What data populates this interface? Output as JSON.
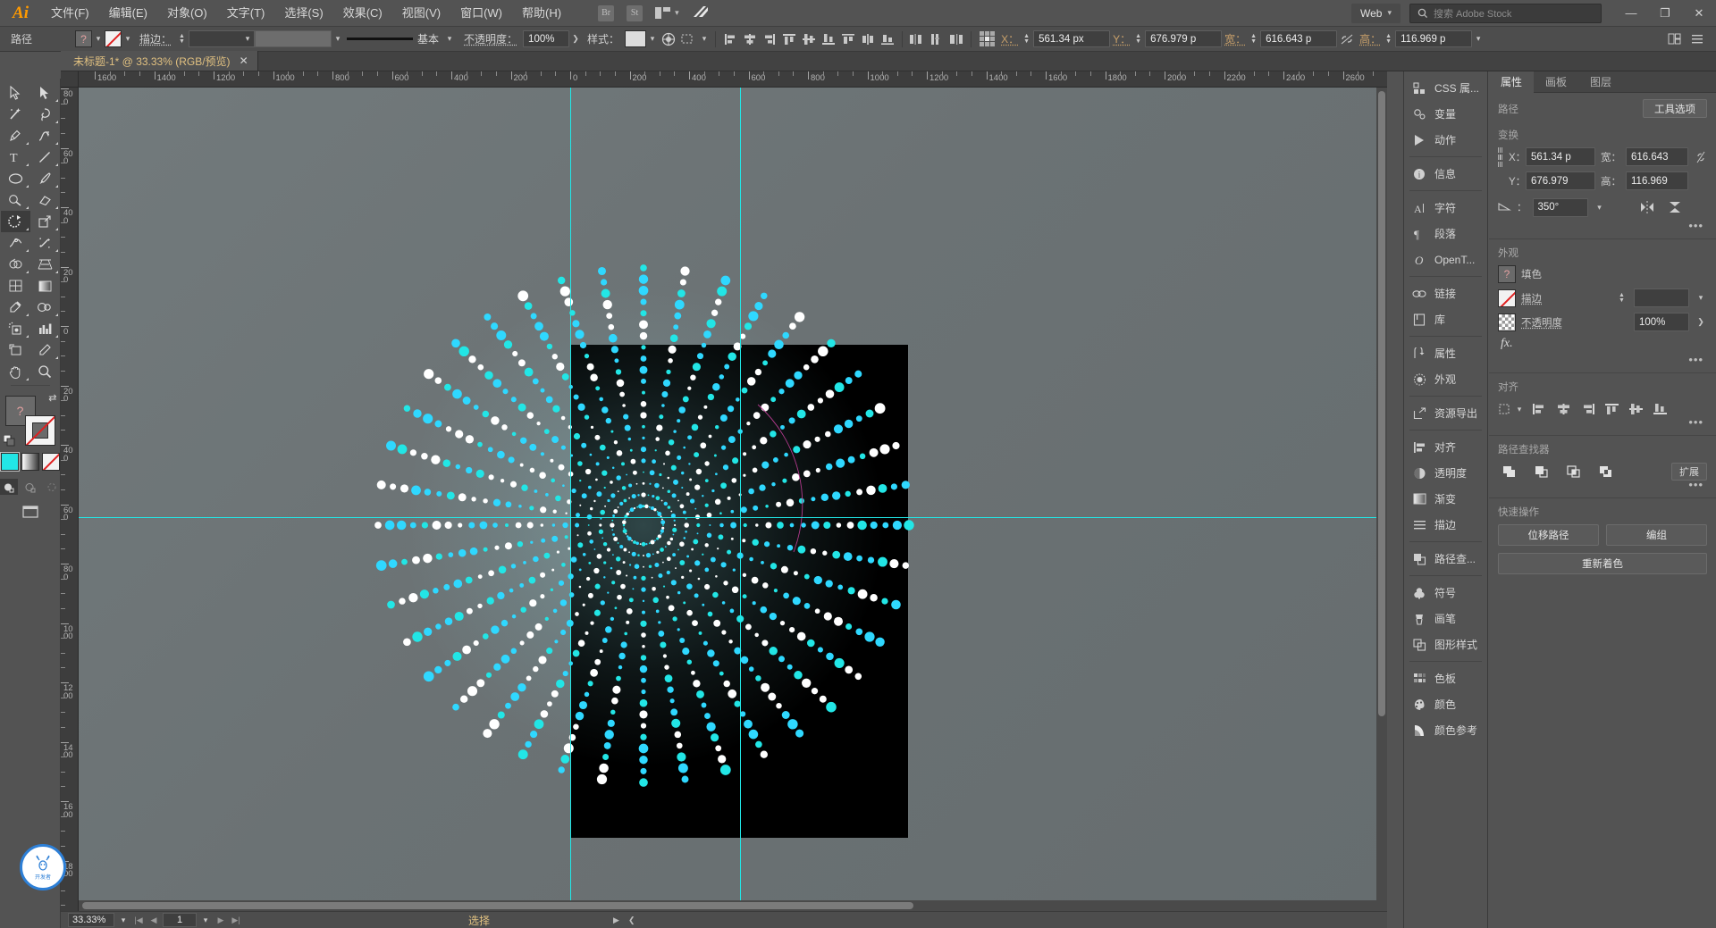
{
  "app": {
    "name": "Adobe Illustrator",
    "logo": "Ai"
  },
  "menubar": {
    "items": [
      {
        "label": "文件(F)"
      },
      {
        "label": "编辑(E)"
      },
      {
        "label": "对象(O)"
      },
      {
        "label": "文字(T)"
      },
      {
        "label": "选择(S)"
      },
      {
        "label": "效果(C)"
      },
      {
        "label": "视图(V)"
      },
      {
        "label": "窗口(W)"
      },
      {
        "label": "帮助(H)"
      }
    ],
    "bridge_label": "Br",
    "stock_label": "St",
    "workspace_label": "Web",
    "search_placeholder": "搜索 Adobe Stock",
    "window_minimize": "—",
    "window_restore": "❐",
    "window_close": "✕"
  },
  "controlbar": {
    "object_type": "路径",
    "fill_swatch": "?",
    "stroke_label": "描边：",
    "stroke_weight": "",
    "brush_label": "基本",
    "opacity_label": "不透明度：",
    "opacity_value": "100%",
    "style_label": "样式：",
    "x_label": "X：",
    "x_value": "561.34 px",
    "y_label": "Y：",
    "y_value": "676.979 p",
    "w_label": "宽：",
    "w_value": "616.643 p",
    "h_label": "高：",
    "h_value": "116.969 p"
  },
  "tabs": [
    {
      "title": "未标题-1* @ 33.33% (RGB/预览)",
      "close": "✕",
      "active": true
    }
  ],
  "toolbar": {
    "tools": [
      {
        "name": "selection-tool",
        "label": "选择工具"
      },
      {
        "name": "direct-selection-tool",
        "label": "直接选择工具"
      },
      {
        "name": "magic-wand-tool",
        "label": "魔棒工具"
      },
      {
        "name": "lasso-tool",
        "label": "套索工具"
      },
      {
        "name": "pen-tool",
        "label": "钢笔工具"
      },
      {
        "name": "curvature-tool",
        "label": "曲率工具"
      },
      {
        "name": "type-tool",
        "label": "文字工具"
      },
      {
        "name": "line-segment-tool",
        "label": "直线段工具"
      },
      {
        "name": "ellipse-tool",
        "label": "椭圆工具"
      },
      {
        "name": "paintbrush-tool",
        "label": "画笔工具"
      },
      {
        "name": "shaper-tool",
        "label": "Shaper 工具"
      },
      {
        "name": "eraser-tool",
        "label": "橡皮擦工具"
      },
      {
        "name": "rotate-tool",
        "label": "旋转工具"
      },
      {
        "name": "scale-tool",
        "label": "比例缩放工具"
      },
      {
        "name": "width-tool",
        "label": "宽度工具"
      },
      {
        "name": "free-transform-tool",
        "label": "自由变换工具"
      },
      {
        "name": "shape-builder-tool",
        "label": "形状生成器工具"
      },
      {
        "name": "perspective-grid-tool",
        "label": "透视网格工具"
      },
      {
        "name": "mesh-tool",
        "label": "网格工具"
      },
      {
        "name": "gradient-tool",
        "label": "渐变工具"
      },
      {
        "name": "eyedropper-tool",
        "label": "吸管工具"
      },
      {
        "name": "blend-tool",
        "label": "混合工具"
      },
      {
        "name": "symbol-sprayer-tool",
        "label": "符号喷枪工具"
      },
      {
        "name": "column-graph-tool",
        "label": "柱形图工具"
      },
      {
        "name": "artboard-tool",
        "label": "画板工具"
      },
      {
        "name": "slice-tool",
        "label": "切片工具"
      },
      {
        "name": "hand-tool",
        "label": "抓手工具"
      },
      {
        "name": "zoom-tool",
        "label": "缩放工具"
      }
    ],
    "active_tool": "rotate-tool",
    "fill_swatch": "?",
    "color_modes": [
      "color",
      "gradient",
      "none"
    ],
    "selected_color": "#22e6e6"
  },
  "rulers": {
    "unit": "px",
    "h_labels": [
      "1600",
      "1400",
      "1200",
      "1000",
      "800",
      "600",
      "400",
      "200",
      "0",
      "200",
      "400",
      "600",
      "800",
      "1000",
      "1200",
      "1400",
      "1600",
      "1800",
      "2000",
      "2200",
      "2400",
      "2600"
    ],
    "v_labels": [
      "800",
      "600",
      "400",
      "200",
      "0",
      "200",
      "400",
      "600",
      "800",
      "1000",
      "1200",
      "1400",
      "1600",
      "1800"
    ]
  },
  "canvas": {
    "artboard_fill": "#000000",
    "guide_color": "#21e8e8",
    "zoom": "33.33%",
    "graphic": {
      "description": "radial dotted sunburst",
      "ray_count": 40,
      "dots_per_ray": 22,
      "colors": [
        "#22e6e6",
        "#ffffff",
        "#2fd8ff"
      ]
    }
  },
  "statusbar": {
    "zoom": "33.33%",
    "artboard_number": "1",
    "status_text": "选择",
    "nav_first": "|◀",
    "nav_prev": "◀",
    "nav_next": "▶",
    "nav_last": "▶|"
  },
  "dock": {
    "groups": [
      {
        "items": [
          {
            "label": "CSS 属...",
            "icon": "css-icon",
            "name": "css-properties"
          },
          {
            "label": "变量",
            "icon": "variables-icon",
            "name": "variables"
          },
          {
            "label": "动作",
            "icon": "actions-icon",
            "name": "actions"
          }
        ]
      },
      {
        "items": [
          {
            "label": "信息",
            "icon": "info-icon",
            "name": "info"
          }
        ]
      },
      {
        "items": [
          {
            "label": "字符",
            "icon": "character-icon",
            "name": "character"
          },
          {
            "label": "段落",
            "icon": "paragraph-icon",
            "name": "paragraph"
          },
          {
            "label": "OpenT...",
            "icon": "opentype-icon",
            "name": "opentype"
          }
        ]
      },
      {
        "items": [
          {
            "label": "链接",
            "icon": "links-icon",
            "name": "links"
          },
          {
            "label": "库",
            "icon": "libraries-icon",
            "name": "libraries"
          }
        ]
      },
      {
        "items": [
          {
            "label": "属性",
            "icon": "attributes-icon",
            "name": "attributes"
          },
          {
            "label": "外观",
            "icon": "appearance-icon",
            "name": "appearance"
          }
        ]
      },
      {
        "items": [
          {
            "label": "资源导出",
            "icon": "asset-export-icon",
            "name": "asset-export"
          }
        ]
      },
      {
        "items": [
          {
            "label": "对齐",
            "icon": "align-icon",
            "name": "align"
          },
          {
            "label": "透明度",
            "icon": "transparency-icon",
            "name": "transparency"
          },
          {
            "label": "渐变",
            "icon": "gradient-icon",
            "name": "gradient"
          },
          {
            "label": "描边",
            "icon": "stroke-icon",
            "name": "stroke"
          }
        ]
      },
      {
        "items": [
          {
            "label": "路径查...",
            "icon": "pathfinder-icon",
            "name": "pathfinder"
          }
        ]
      },
      {
        "items": [
          {
            "label": "符号",
            "icon": "symbols-icon",
            "name": "symbols"
          },
          {
            "label": "画笔",
            "icon": "brushes-icon",
            "name": "brushes"
          },
          {
            "label": "图形样式",
            "icon": "graphic-styles-icon",
            "name": "graphic-styles"
          }
        ]
      },
      {
        "items": [
          {
            "label": "色板",
            "icon": "swatches-icon",
            "name": "swatches"
          },
          {
            "label": "颜色",
            "icon": "color-icon",
            "name": "color"
          },
          {
            "label": "颜色参考",
            "icon": "color-guide-icon",
            "name": "color-guide"
          }
        ]
      }
    ],
    "badge_text": "开发者"
  },
  "properties": {
    "tabs": [
      {
        "label": "属性",
        "active": true
      },
      {
        "label": "画板",
        "active": false
      },
      {
        "label": "图层",
        "active": false
      }
    ],
    "path_label": "路径",
    "tool_options_label": "工具选项",
    "transform": {
      "title": "变换",
      "x_label": "X：",
      "x_value": "561.34 p",
      "y_label": "Y：",
      "y_value": "676.979",
      "w_label": "宽：",
      "w_value": "616.643",
      "h_label": "高：",
      "h_value": "116.969",
      "angle_value": "350°"
    },
    "appearance": {
      "title": "外观",
      "fill_label": "填色",
      "fill_swatch": "?",
      "stroke_label": "描边",
      "stroke_weight": "",
      "opacity_label": "不透明度",
      "opacity_value": "100%",
      "fx_label": "fx."
    },
    "align": {
      "title": "对齐"
    },
    "pathfinder": {
      "title": "路径查找器",
      "expand_label": "扩展"
    },
    "quick_actions": {
      "title": "快速操作",
      "buttons": [
        "位移路径",
        "编组",
        "重新着色"
      ]
    }
  }
}
